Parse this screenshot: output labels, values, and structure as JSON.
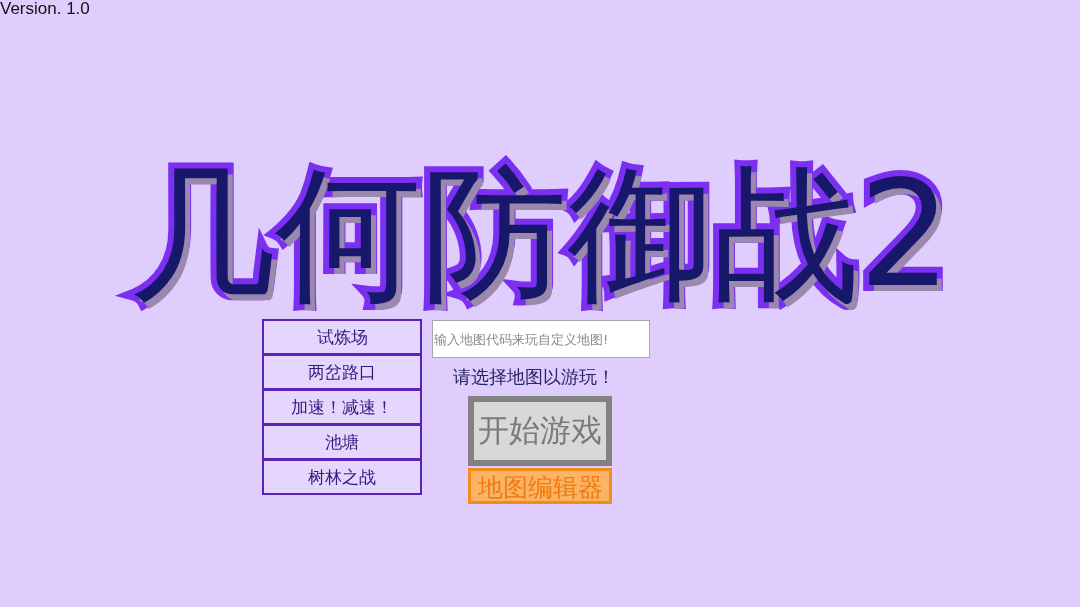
{
  "version": "Version. 1.0",
  "title": "几何防御战2",
  "maps": [
    {
      "label": "试炼场",
      "selected": false
    },
    {
      "label": "两岔路口",
      "selected": false
    },
    {
      "label": "加速！减速！",
      "selected": false
    },
    {
      "label": "池塘",
      "selected": false
    },
    {
      "label": "树林之战",
      "selected": false
    }
  ],
  "map_code": {
    "placeholder": "输入地图代码来玩自定义地图!"
  },
  "hint": "请选择地图以游玩！",
  "start_button": {
    "label": "开始游戏",
    "disabled": true
  },
  "editor_button": {
    "label": "地图编辑器"
  }
}
